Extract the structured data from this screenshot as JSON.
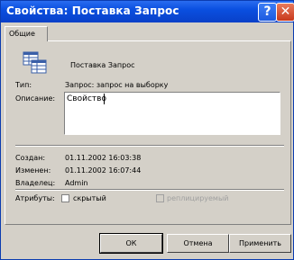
{
  "window": {
    "title": "Свойства: Поставка Запрос",
    "help_glyph": "?",
    "close_glyph": "✕"
  },
  "tabs": [
    {
      "label": "Общие"
    }
  ],
  "object": {
    "name": "Поставка Запрос"
  },
  "fields": {
    "type_label": "Тип:",
    "type_value": "Запрос: запрос на выборку",
    "description_label": "Описание:",
    "description_value": "Свойство",
    "created_label": "Создан:",
    "created_value": "01.11.2002 16:03:38",
    "modified_label": "Изменен:",
    "modified_value": "01.11.2002 16:07:44",
    "owner_label": "Владелец:",
    "owner_value": "Admin"
  },
  "attributes": {
    "label": "Атрибуты:",
    "hidden_label": "скрытый",
    "hidden_checked": false,
    "replicated_label": "реплицируемый",
    "replicated_checked": false
  },
  "buttons": {
    "ok": "ОК",
    "cancel": "Отмена",
    "apply": "Применить"
  }
}
